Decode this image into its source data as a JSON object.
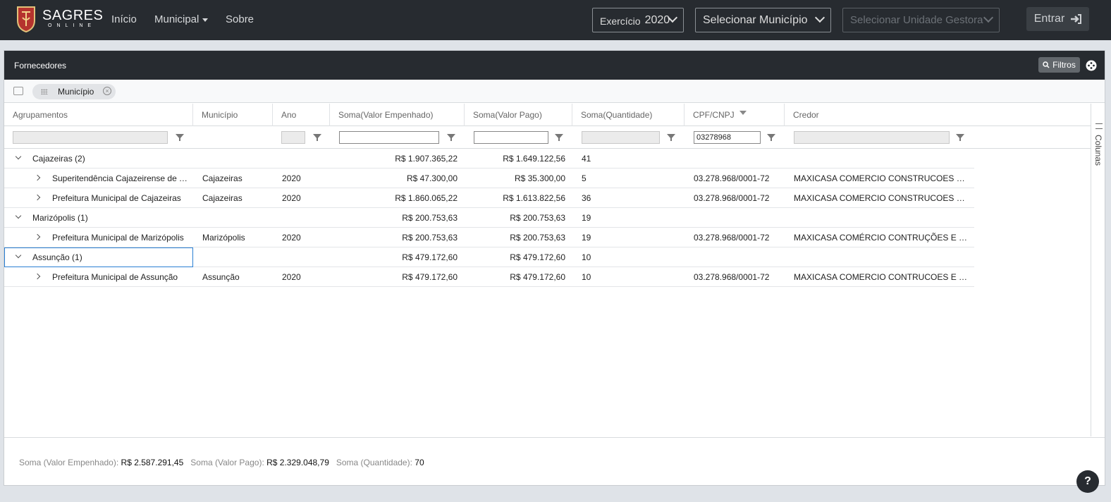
{
  "navbar": {
    "brand_main": "SAGRES",
    "brand_sub": "ONLINE",
    "links": {
      "inicio": "Início",
      "municipal": "Municipal",
      "sobre": "Sobre"
    },
    "exercicio_label": "Exercício",
    "exercicio_value": "2020",
    "municipio_placeholder": "Selecionar Município",
    "unidade_placeholder": "Selecionar Unidade Gestora",
    "entrar_label": "Entrar"
  },
  "panel": {
    "title": "Fornecedores",
    "filtros_label": "Filtros",
    "group_chip": "Município",
    "columns_tab": "Colunas"
  },
  "grid": {
    "headers": [
      "Agrupamentos",
      "Município",
      "Ano",
      "Soma(Valor Empenhado)",
      "Soma(Valor Pago)",
      "Soma(Quantidade)",
      "CPF/CNPJ",
      "Credor"
    ],
    "filters": {
      "cpf_cnpj": "03278968"
    },
    "rows": [
      {
        "type": "group",
        "label": "Cajazeiras (2)",
        "empenhado": "R$ 1.907.365,22",
        "pago": "R$ 1.649.122,56",
        "quantidade": "41"
      },
      {
        "type": "item",
        "label": "Superitendência Cajazeirense de Tr...",
        "municipio": "Cajazeiras",
        "ano": "2020",
        "empenhado": "R$ 47.300,00",
        "pago": "R$ 35.300,00",
        "quantidade": "5",
        "cnpj": "03.278.968/0001-72",
        "credor": "MAXICASA COMERCIO CONSTRUCOES E SE..."
      },
      {
        "type": "item",
        "label": "Prefeitura Municipal de Cajazeiras",
        "municipio": "Cajazeiras",
        "ano": "2020",
        "empenhado": "R$ 1.860.065,22",
        "pago": "R$ 1.613.822,56",
        "quantidade": "36",
        "cnpj": "03.278.968/0001-72",
        "credor": "MAXICASA COMERCIO CONSTRUCOES E SE..."
      },
      {
        "type": "group",
        "label": "Marizópolis (1)",
        "empenhado": "R$ 200.753,63",
        "pago": "R$ 200.753,63",
        "quantidade": "19"
      },
      {
        "type": "item",
        "label": "Prefeitura Municipal de Marizópolis",
        "municipio": "Marizópolis",
        "ano": "2020",
        "empenhado": "R$ 200.753,63",
        "pago": "R$ 200.753,63",
        "quantidade": "19",
        "cnpj": "03.278.968/0001-72",
        "credor": "MAXICASA COMÉRCIO CONTRUÇÕES E SER..."
      },
      {
        "type": "group",
        "label": "Assunção (1)",
        "empenhado": "R$ 479.172,60",
        "pago": "R$ 479.172,60",
        "quantidade": "10"
      },
      {
        "type": "item",
        "label": "Prefeitura Municipal de Assunção",
        "municipio": "Assunção",
        "ano": "2020",
        "empenhado": "R$ 479.172,60",
        "pago": "R$ 479.172,60",
        "quantidade": "10",
        "cnpj": "03.278.968/0001-72",
        "credor": "MAXICASA COMERCIO CONTRUCOES E SER..."
      }
    ]
  },
  "footer": {
    "empenhado_label": "Soma (Valor Empenhado):",
    "empenhado_value": "R$ 2.587.291,45",
    "pago_label": "Soma (Valor Pago):",
    "pago_value": "R$ 2.329.048,79",
    "quantidade_label": "Soma (Quantidade):",
    "quantidade_value": "70"
  },
  "help_label": "?"
}
